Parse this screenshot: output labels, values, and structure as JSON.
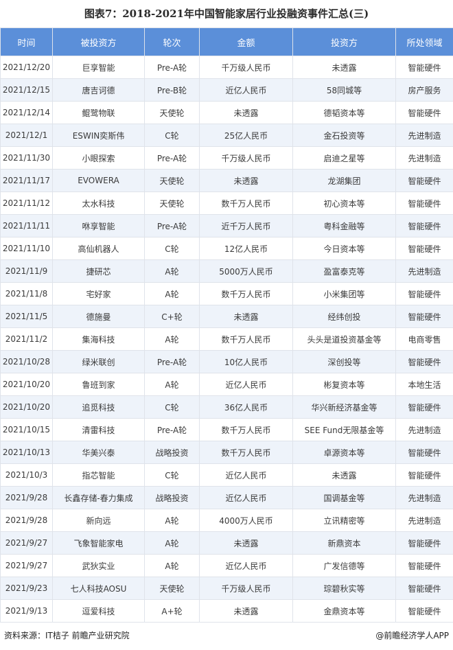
{
  "title": "图表7：2018-2021年中国智能家居行业投融资事件汇总(三)",
  "columns": [
    "时间",
    "被投资方",
    "轮次",
    "金额",
    "投资方",
    "所处领域"
  ],
  "rows": [
    [
      "2021/12/20",
      "巨享智能",
      "Pre-A轮",
      "千万级人民币",
      "未透露",
      "智能硬件"
    ],
    [
      "2021/12/15",
      "唐吉诃德",
      "Pre-B轮",
      "近亿人民币",
      "58同城等",
      "房产服务"
    ],
    [
      "2021/12/14",
      "鲲鹭物联",
      "天使轮",
      "未透露",
      "德韬资本等",
      "智能硬件"
    ],
    [
      "2021/12/1",
      "ESWIN奕斯伟",
      "C轮",
      "25亿人民币",
      "金石投资等",
      "先进制造"
    ],
    [
      "2021/11/30",
      "小眼探索",
      "Pre-A轮",
      "千万级人民币",
      "启迪之星等",
      "先进制造"
    ],
    [
      "2021/11/17",
      "EVOWERA",
      "天使轮",
      "未透露",
      "龙湖集团",
      "智能硬件"
    ],
    [
      "2021/11/12",
      "太水科技",
      "天使轮",
      "数千万人民币",
      "初心资本等",
      "智能硬件"
    ],
    [
      "2021/11/11",
      "咻享智能",
      "Pre-A轮",
      "近千万人民币",
      "粤科金融等",
      "智能硬件"
    ],
    [
      "2021/11/10",
      "高仙机器人",
      "C轮",
      "12亿人民币",
      "今日资本等",
      "智能硬件"
    ],
    [
      "2021/11/9",
      "捷研芯",
      "A轮",
      "5000万人民币",
      "盈富泰克等",
      "先进制造"
    ],
    [
      "2021/11/8",
      "宅好家",
      "A轮",
      "数千万人民币",
      "小米集团等",
      "智能硬件"
    ],
    [
      "2021/11/5",
      "德施曼",
      "C+轮",
      "未透露",
      "经纬创投",
      "智能硬件"
    ],
    [
      "2021/11/2",
      "集海科技",
      "A轮",
      "数千万人民币",
      "头头是道投资基金等",
      "电商零售"
    ],
    [
      "2021/10/28",
      "绿米联创",
      "Pre-A轮",
      "10亿人民币",
      "深创投等",
      "智能硬件"
    ],
    [
      "2021/10/20",
      "鲁班到家",
      "A轮",
      "近亿人民币",
      "彬复资本等",
      "本地生活"
    ],
    [
      "2021/10/20",
      "追觅科技",
      "C轮",
      "36亿人民币",
      "华兴新经济基金等",
      "智能硬件"
    ],
    [
      "2021/10/15",
      "清雷科技",
      "Pre-A轮",
      "数千万人民币",
      "SEE Fund无限基金等",
      "先进制造"
    ],
    [
      "2021/10/13",
      "华美兴泰",
      "战略投资",
      "数千万人民币",
      "卓源资本等",
      "智能硬件"
    ],
    [
      "2021/10/3",
      "指芯智能",
      "C轮",
      "近亿人民币",
      "未透露",
      "智能硬件"
    ],
    [
      "2021/9/28",
      "长鑫存储-春力集成",
      "战略投资",
      "近亿人民币",
      "国调基金等",
      "先进制造"
    ],
    [
      "2021/9/28",
      "新向远",
      "A轮",
      "4000万人民币",
      "立讯精密等",
      "先进制造"
    ],
    [
      "2021/9/27",
      "飞象智能家电",
      "A轮",
      "未透露",
      "新鼎资本",
      "智能硬件"
    ],
    [
      "2021/9/27",
      "武狄实业",
      "A轮",
      "近亿人民币",
      "广发信德等",
      "智能硬件"
    ],
    [
      "2021/9/23",
      "七人科技AOSU",
      "天使轮",
      "千万级人民币",
      "琮碧秋实等",
      "智能硬件"
    ],
    [
      "2021/9/13",
      "逗爱科技",
      "A+轮",
      "未透露",
      "金鼎资本等",
      "智能硬件"
    ]
  ],
  "footer": {
    "source": "资料来源：IT桔子 前瞻产业研究院",
    "brand": "@前瞻经济学人APP"
  }
}
